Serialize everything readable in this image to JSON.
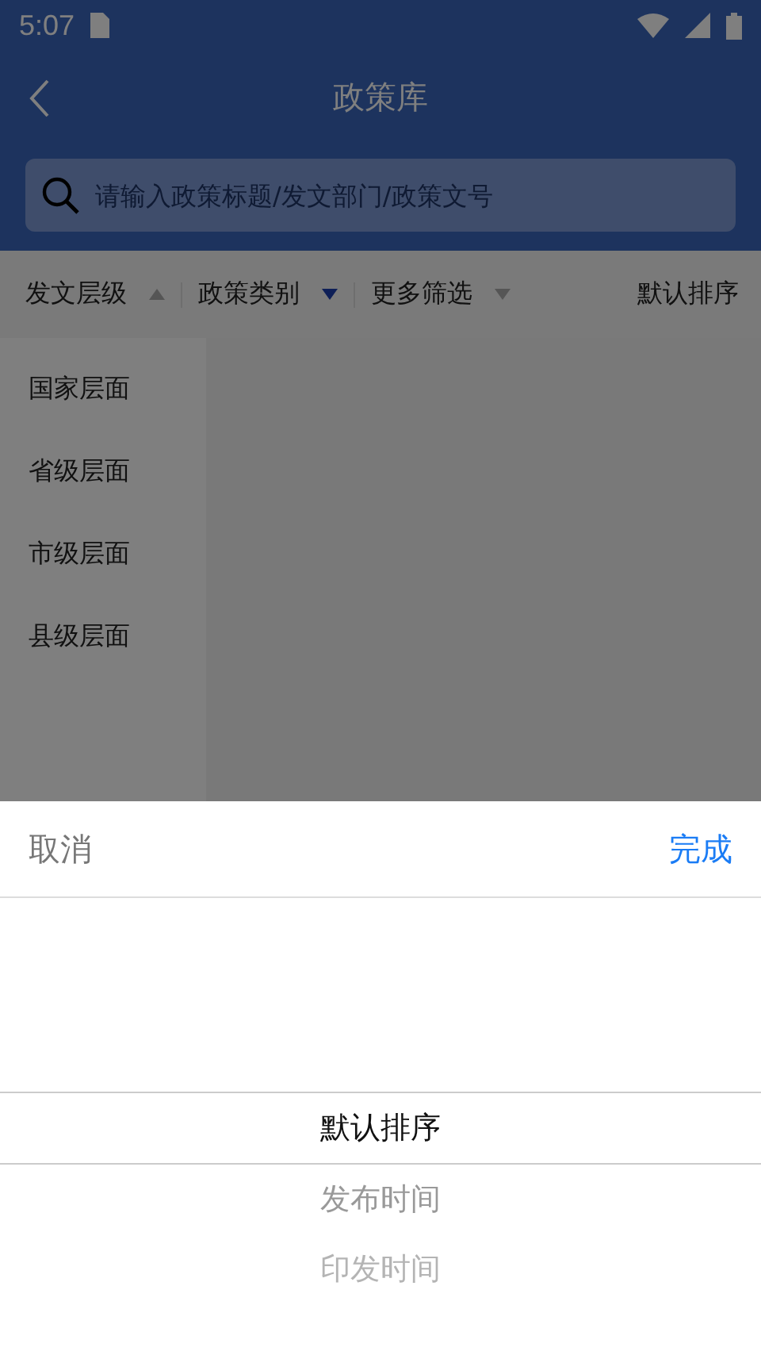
{
  "status_bar": {
    "time": "5:07"
  },
  "header": {
    "title": "政策库"
  },
  "search": {
    "placeholder": "请输入政策标题/发文部门/政策文号"
  },
  "filters": [
    {
      "label": "发文层级",
      "kind": "dropdown",
      "expanded": true,
      "active": false
    },
    {
      "label": "政策类别",
      "kind": "dropdown",
      "expanded": false,
      "active": true
    },
    {
      "label": "更多筛选",
      "kind": "dropdown",
      "expanded": false,
      "active": false
    },
    {
      "label": "默认排序",
      "kind": "plain"
    }
  ],
  "levels": [
    {
      "label": "国家层面"
    },
    {
      "label": "省级层面"
    },
    {
      "label": "市级层面"
    },
    {
      "label": "县级层面"
    }
  ],
  "picker": {
    "cancel": "取消",
    "done": "完成",
    "options": [
      {
        "label": "默认排序",
        "selected": true
      },
      {
        "label": "发布时间",
        "selected": false
      },
      {
        "label": "印发时间",
        "selected": false
      }
    ]
  }
}
